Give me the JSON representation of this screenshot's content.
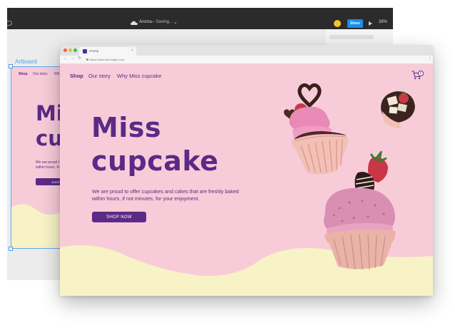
{
  "editor": {
    "document_name": "Aroma",
    "status": "— Saving...",
    "share_label": "Share",
    "zoom": "38%",
    "artboard_label": "Artboard",
    "artboard": {
      "nav": [
        "Shop",
        "Our story",
        "Wh"
      ],
      "title_lines": [
        "Mi",
        "cu"
      ],
      "text_lines": [
        "We are proud t",
        "within hours, if n"
      ],
      "button_label": "SHOP N"
    }
  },
  "browser": {
    "tab_title": "Aroma",
    "url": "https://www.aromaapp.com"
  },
  "site": {
    "nav": {
      "shop": "Shop",
      "our_story": "Our story",
      "why": "Why Miss cupcake"
    },
    "cart_count": "0",
    "hero_title_lines": [
      "Miss",
      "cupcake"
    ],
    "hero_text_lines": [
      "We are proud to offer cupcakes and cakes that are freshly baked",
      "within hours, if not minutes, for your enjoyment."
    ],
    "shop_now_label": "SHOP NOW"
  },
  "colors": {
    "brand_purple": "#5b2a86",
    "pink_bg": "#f7ccd8",
    "cream_wave": "#f8f3c7",
    "share_blue": "#1a8cf0"
  }
}
